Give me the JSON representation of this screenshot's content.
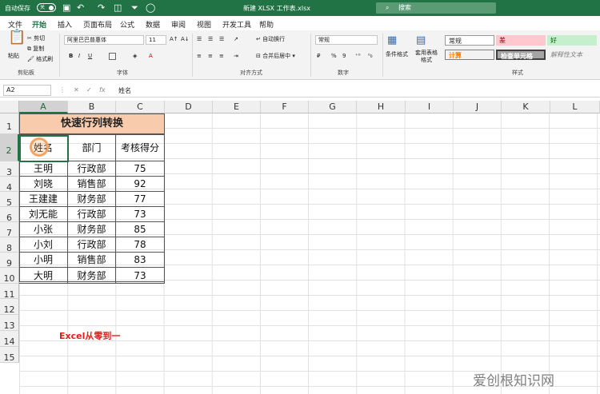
{
  "titlebar": {
    "autosave": "自动保存",
    "toggle": "关",
    "filename": "新建 XLSX 工作表.xlsx",
    "search": "搜索"
  },
  "tabs": [
    "文件",
    "开始",
    "插入",
    "页面布局",
    "公式",
    "数据",
    "审阅",
    "视图",
    "开发工具",
    "帮助"
  ],
  "active_tab": "开始",
  "ribbon": {
    "clipboard": {
      "paste": "粘贴",
      "cut": "剪切",
      "copy": "复制",
      "format_painter": "格式刷",
      "group": "剪贴板"
    },
    "font": {
      "name": "阿里巴巴普惠体",
      "size": "11",
      "group": "字体",
      "bold": "B",
      "italic": "I",
      "underline": "U"
    },
    "align": {
      "wrap": "自动换行",
      "merge": "合并后居中",
      "group": "对齐方式"
    },
    "number": {
      "format": "常规",
      "group": "数字",
      "percent": "%",
      "comma": "9"
    },
    "styles": {
      "conditional": "条件格式",
      "table": "套用表格格式",
      "normal": "常规",
      "bad": "差",
      "good": "好",
      "calc": "计算",
      "check": "检查单元格",
      "explain": "解释性文本",
      "group": "样式"
    }
  },
  "formula": {
    "namebox": "A2",
    "value": "姓名"
  },
  "columns": [
    "A",
    "B",
    "C",
    "D",
    "E",
    "F",
    "G",
    "H",
    "I",
    "J",
    "K",
    "L"
  ],
  "rows": [
    "1",
    "2",
    "3",
    "4",
    "5",
    "6",
    "7",
    "8",
    "9",
    "10",
    "11",
    "12",
    "13",
    "14",
    "15"
  ],
  "sheet": {
    "title": "快速行列转换",
    "headers": [
      "姓名",
      "部门",
      "考核得分"
    ],
    "data": [
      [
        "王明",
        "行政部",
        "75"
      ],
      [
        "刘晓",
        "销售部",
        "92"
      ],
      [
        "王建建",
        "财务部",
        "77"
      ],
      [
        "刘无能",
        "行政部",
        "73"
      ],
      [
        "小张",
        "财务部",
        "85"
      ],
      [
        "小刘",
        "行政部",
        "78"
      ],
      [
        "小明",
        "销售部",
        "83"
      ],
      [
        "大明",
        "财务部",
        "73"
      ]
    ],
    "note": "Excel从零到一"
  },
  "watermark": "爱创根知识网",
  "colors": {
    "accent": "#217346",
    "title_fill": "#f8cbad",
    "note": "#e81c1c",
    "ring": "#f4a460"
  }
}
